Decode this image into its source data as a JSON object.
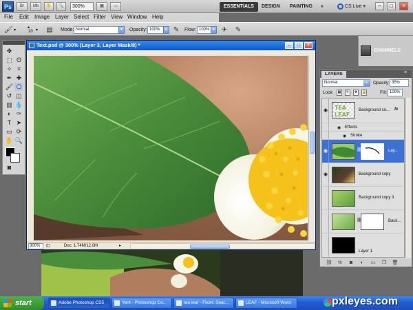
{
  "app": {
    "logo": "Ps",
    "zoom": "300%",
    "workspaces": [
      "ESSENTIALS",
      "DESIGN",
      "PAINTING",
      "»"
    ],
    "cs_live": "CS Live ▾",
    "window_controls": [
      "–",
      "□",
      "×"
    ]
  },
  "menu": [
    "File",
    "Edit",
    "Image",
    "Layer",
    "Select",
    "Filter",
    "View",
    "Window",
    "Help"
  ],
  "options": {
    "brush_size": "10",
    "mode_label": "Mode:",
    "mode_value": "Normal",
    "opacity_label": "Opacity:",
    "opacity_value": "100%",
    "flow_label": "Flow:",
    "flow_value": "100%"
  },
  "document": {
    "title": "Text.psd @ 300% (Layer 3, Layer Mask/8) *",
    "zoom": "300%",
    "info": "Doc: 1.74M/12.0M"
  },
  "dock": {
    "channels": "CHANNELS"
  },
  "layers_panel": {
    "tab": "LAYERS",
    "blend_mode": "Normal",
    "opacity_label": "Opacity:",
    "opacity_value": "35%",
    "lock_label": "Lock:",
    "fill_label": "Fill:",
    "fill_value": "100%",
    "layers": [
      {
        "name": "Background co...",
        "fx": "fx"
      },
      {
        "name": "Effects"
      },
      {
        "name": "Stroke"
      },
      {
        "name": "Lay..."
      },
      {
        "name": "Background copy"
      },
      {
        "name": "Background copy 3"
      },
      {
        "name": "Back..."
      },
      {
        "name": "Layer 1"
      }
    ]
  },
  "taskbar": {
    "start": "start",
    "tasks": [
      "Adobe Photoshop CS5",
      "Yerit - Photoshop Co...",
      "tea leaf - Flickr: Sear...",
      "LEAF - Microsoft Word"
    ],
    "watermark": "pxleyes.com"
  },
  "colors": {
    "selected_layer": "#3d72d2",
    "titlebar": "#0b58d4",
    "taskbar": "#225dd0"
  }
}
